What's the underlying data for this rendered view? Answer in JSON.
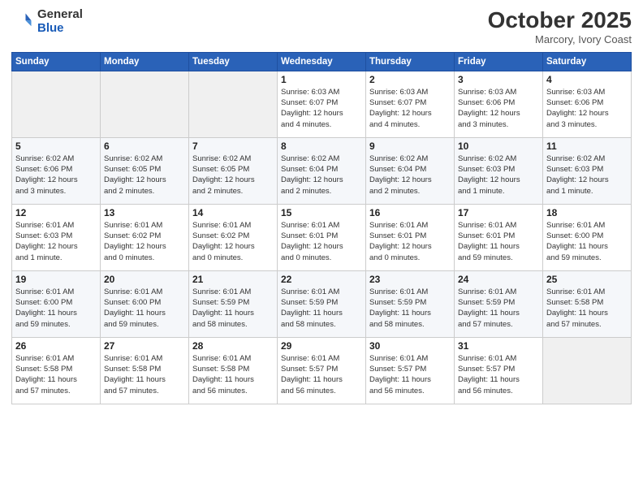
{
  "header": {
    "logo_line1": "General",
    "logo_line2": "Blue",
    "month": "October 2025",
    "location": "Marcory, Ivory Coast"
  },
  "weekdays": [
    "Sunday",
    "Monday",
    "Tuesday",
    "Wednesday",
    "Thursday",
    "Friday",
    "Saturday"
  ],
  "weeks": [
    [
      {
        "day": "",
        "info": ""
      },
      {
        "day": "",
        "info": ""
      },
      {
        "day": "",
        "info": ""
      },
      {
        "day": "1",
        "info": "Sunrise: 6:03 AM\nSunset: 6:07 PM\nDaylight: 12 hours\nand 4 minutes."
      },
      {
        "day": "2",
        "info": "Sunrise: 6:03 AM\nSunset: 6:07 PM\nDaylight: 12 hours\nand 4 minutes."
      },
      {
        "day": "3",
        "info": "Sunrise: 6:03 AM\nSunset: 6:06 PM\nDaylight: 12 hours\nand 3 minutes."
      },
      {
        "day": "4",
        "info": "Sunrise: 6:03 AM\nSunset: 6:06 PM\nDaylight: 12 hours\nand 3 minutes."
      }
    ],
    [
      {
        "day": "5",
        "info": "Sunrise: 6:02 AM\nSunset: 6:06 PM\nDaylight: 12 hours\nand 3 minutes."
      },
      {
        "day": "6",
        "info": "Sunrise: 6:02 AM\nSunset: 6:05 PM\nDaylight: 12 hours\nand 2 minutes."
      },
      {
        "day": "7",
        "info": "Sunrise: 6:02 AM\nSunset: 6:05 PM\nDaylight: 12 hours\nand 2 minutes."
      },
      {
        "day": "8",
        "info": "Sunrise: 6:02 AM\nSunset: 6:04 PM\nDaylight: 12 hours\nand 2 minutes."
      },
      {
        "day": "9",
        "info": "Sunrise: 6:02 AM\nSunset: 6:04 PM\nDaylight: 12 hours\nand 2 minutes."
      },
      {
        "day": "10",
        "info": "Sunrise: 6:02 AM\nSunset: 6:03 PM\nDaylight: 12 hours\nand 1 minute."
      },
      {
        "day": "11",
        "info": "Sunrise: 6:02 AM\nSunset: 6:03 PM\nDaylight: 12 hours\nand 1 minute."
      }
    ],
    [
      {
        "day": "12",
        "info": "Sunrise: 6:01 AM\nSunset: 6:03 PM\nDaylight: 12 hours\nand 1 minute."
      },
      {
        "day": "13",
        "info": "Sunrise: 6:01 AM\nSunset: 6:02 PM\nDaylight: 12 hours\nand 0 minutes."
      },
      {
        "day": "14",
        "info": "Sunrise: 6:01 AM\nSunset: 6:02 PM\nDaylight: 12 hours\nand 0 minutes."
      },
      {
        "day": "15",
        "info": "Sunrise: 6:01 AM\nSunset: 6:01 PM\nDaylight: 12 hours\nand 0 minutes."
      },
      {
        "day": "16",
        "info": "Sunrise: 6:01 AM\nSunset: 6:01 PM\nDaylight: 12 hours\nand 0 minutes."
      },
      {
        "day": "17",
        "info": "Sunrise: 6:01 AM\nSunset: 6:01 PM\nDaylight: 11 hours\nand 59 minutes."
      },
      {
        "day": "18",
        "info": "Sunrise: 6:01 AM\nSunset: 6:00 PM\nDaylight: 11 hours\nand 59 minutes."
      }
    ],
    [
      {
        "day": "19",
        "info": "Sunrise: 6:01 AM\nSunset: 6:00 PM\nDaylight: 11 hours\nand 59 minutes."
      },
      {
        "day": "20",
        "info": "Sunrise: 6:01 AM\nSunset: 6:00 PM\nDaylight: 11 hours\nand 59 minutes."
      },
      {
        "day": "21",
        "info": "Sunrise: 6:01 AM\nSunset: 5:59 PM\nDaylight: 11 hours\nand 58 minutes."
      },
      {
        "day": "22",
        "info": "Sunrise: 6:01 AM\nSunset: 5:59 PM\nDaylight: 11 hours\nand 58 minutes."
      },
      {
        "day": "23",
        "info": "Sunrise: 6:01 AM\nSunset: 5:59 PM\nDaylight: 11 hours\nand 58 minutes."
      },
      {
        "day": "24",
        "info": "Sunrise: 6:01 AM\nSunset: 5:59 PM\nDaylight: 11 hours\nand 57 minutes."
      },
      {
        "day": "25",
        "info": "Sunrise: 6:01 AM\nSunset: 5:58 PM\nDaylight: 11 hours\nand 57 minutes."
      }
    ],
    [
      {
        "day": "26",
        "info": "Sunrise: 6:01 AM\nSunset: 5:58 PM\nDaylight: 11 hours\nand 57 minutes."
      },
      {
        "day": "27",
        "info": "Sunrise: 6:01 AM\nSunset: 5:58 PM\nDaylight: 11 hours\nand 57 minutes."
      },
      {
        "day": "28",
        "info": "Sunrise: 6:01 AM\nSunset: 5:58 PM\nDaylight: 11 hours\nand 56 minutes."
      },
      {
        "day": "29",
        "info": "Sunrise: 6:01 AM\nSunset: 5:57 PM\nDaylight: 11 hours\nand 56 minutes."
      },
      {
        "day": "30",
        "info": "Sunrise: 6:01 AM\nSunset: 5:57 PM\nDaylight: 11 hours\nand 56 minutes."
      },
      {
        "day": "31",
        "info": "Sunrise: 6:01 AM\nSunset: 5:57 PM\nDaylight: 11 hours\nand 56 minutes."
      },
      {
        "day": "",
        "info": ""
      }
    ]
  ]
}
